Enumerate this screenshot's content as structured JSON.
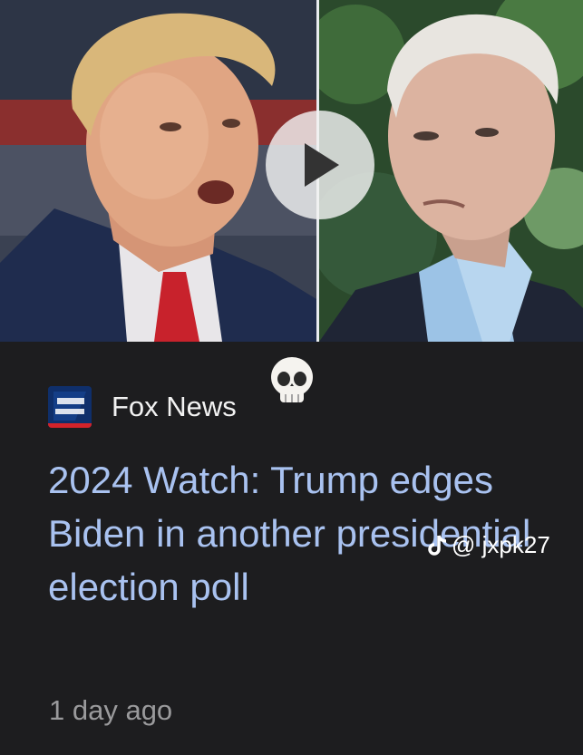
{
  "article": {
    "source_name": "Fox News",
    "source_logo_text": "FOX NEWS",
    "headline": "2024 Watch: Trump edges Biden in another presidential election poll",
    "timestamp": "1 day ago",
    "media": {
      "type": "video",
      "play_icon": "play-icon"
    }
  },
  "overlay": {
    "emoji": "💀",
    "watermark_icon": "tiktok-icon",
    "watermark_text": "@ jxpk27"
  },
  "colors": {
    "background": "#1d1d1f",
    "headline": "#a9c2f0",
    "source_text": "#f2f2f2",
    "timestamp": "#9a9a9c",
    "logo_blue": "#0f2f6b",
    "logo_red": "#d2232a"
  }
}
